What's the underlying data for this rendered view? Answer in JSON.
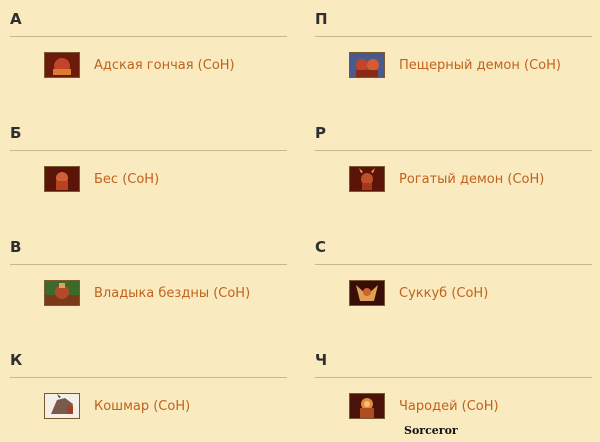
{
  "sections": [
    {
      "letter": "А",
      "item": {
        "label": "Адская гончая (СоН)",
        "icon": "hell-hound-icon"
      }
    },
    {
      "letter": "П",
      "item": {
        "label": "Пещерный демон (СоН)",
        "icon": "cave-demon-icon"
      }
    },
    {
      "letter": "Б",
      "item": {
        "label": "Бес (СоН)",
        "icon": "imp-icon"
      }
    },
    {
      "letter": "Р",
      "item": {
        "label": "Рогатый демон (СоН)",
        "icon": "horned-demon-icon"
      }
    },
    {
      "letter": "В",
      "item": {
        "label": "Владыка бездны (СоН)",
        "icon": "pit-lord-icon"
      }
    },
    {
      "letter": "С",
      "item": {
        "label": "Суккуб (СоН)",
        "icon": "succubus-icon"
      }
    },
    {
      "letter": "К",
      "item": {
        "label": "Кошмар (СоН)",
        "icon": "nightmare-icon"
      }
    },
    {
      "letter": "Ч",
      "item": {
        "label": "Чародей (СоН)",
        "icon": "sorcerer-icon"
      }
    }
  ],
  "tooltip": "Sorceror",
  "colors": {
    "background": "#faeac0",
    "link": "#c0621c",
    "heading": "#2f2f2f",
    "rule": "#c9b78f"
  }
}
